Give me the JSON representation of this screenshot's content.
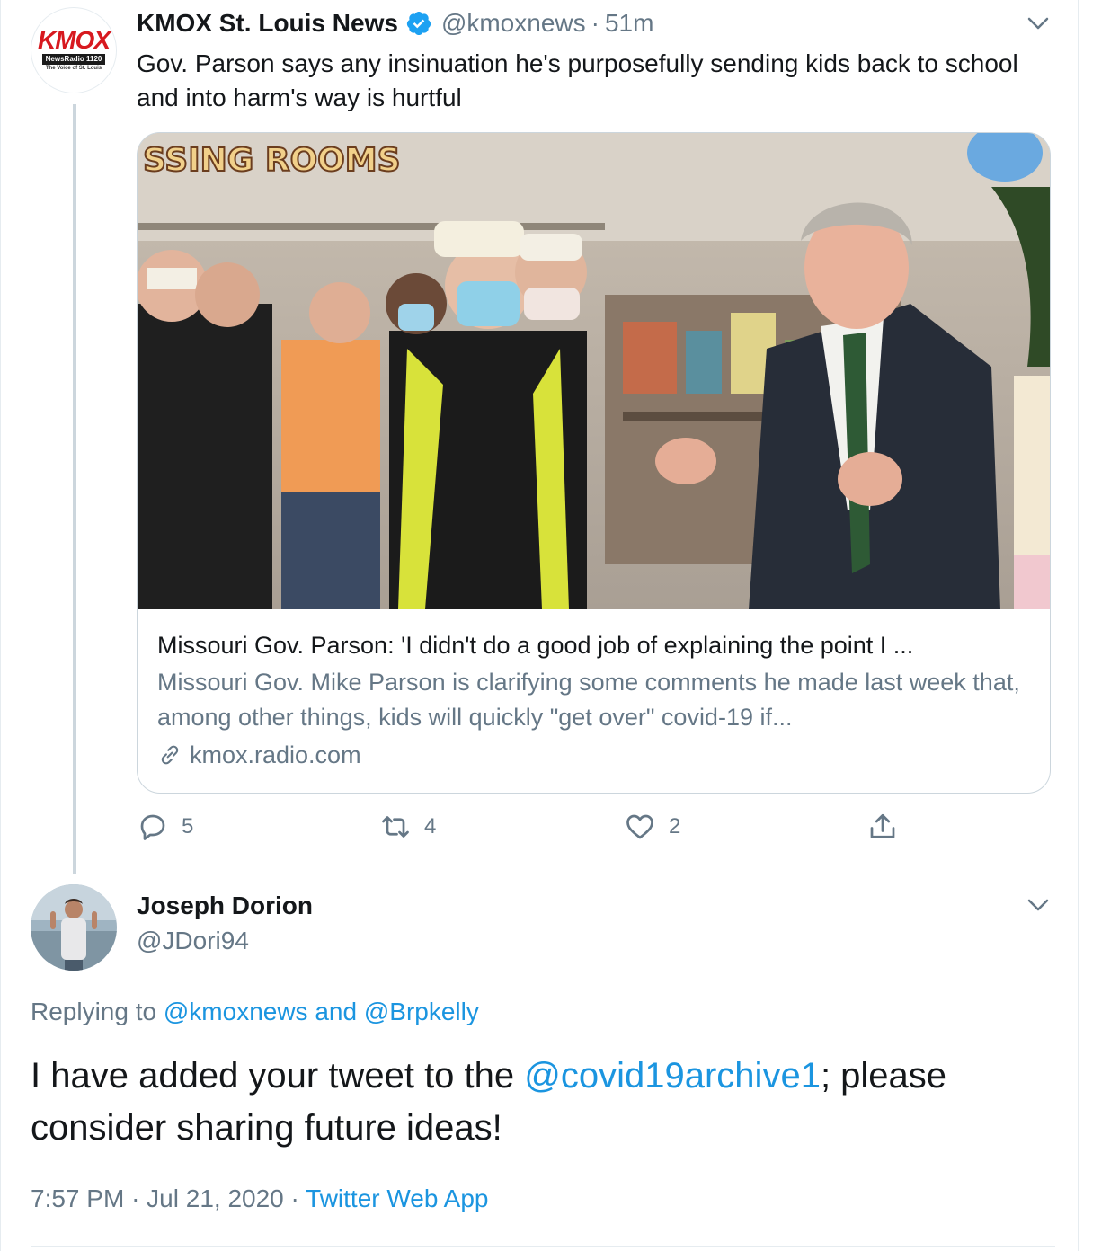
{
  "tweet1": {
    "avatar": {
      "brand": "KMOX",
      "band": "NewsRadio 1120",
      "tagline": "The Voice of St. Louis"
    },
    "display_name": "KMOX St. Louis News",
    "verified_icon": "verified-badge-icon",
    "handle": "@kmoxnews",
    "separator": "·",
    "time": "51m",
    "text": "Gov. Parson says any insinuation he's purposefully sending kids back to school and into harm's way is hurtful",
    "card": {
      "image_sign": "SSING ROOMS",
      "title": "Missouri Gov. Parson: 'I didn't do a good job of explaining the point I ...",
      "description": "Missouri Gov. Mike Parson is clarifying some comments he made last week that, among other things, kids will quickly \"get over\" covid-19 if...",
      "domain": "kmox.radio.com"
    },
    "actions": {
      "reply_count": "5",
      "retweet_count": "4",
      "like_count": "2"
    }
  },
  "tweet2": {
    "display_name": "Joseph Dorion",
    "handle": "@JDori94",
    "replying_prefix": "Replying to ",
    "replying_to_1": "@kmoxnews",
    "replying_and": " and ",
    "replying_to_2": "@Brpkelly",
    "text_before": "I have added your tweet to the ",
    "text_mention": "@covid19archive1",
    "text_after": "; please consider sharing future ideas!",
    "time": "7:57 PM",
    "date": "Jul 21, 2020",
    "separator": "·",
    "source": "Twitter Web App"
  },
  "colors": {
    "link_blue": "#1b95e0",
    "verified_blue": "#1da1f2",
    "secondary_text": "#657786",
    "border": "#ccd6dd",
    "kmox_red": "#d7191f"
  }
}
